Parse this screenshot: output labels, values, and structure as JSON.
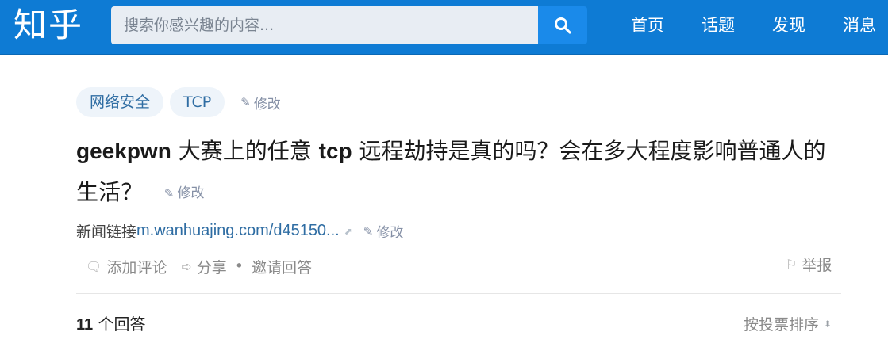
{
  "header": {
    "logo": "知乎",
    "search": {
      "placeholder": "搜索你感兴趣的内容...",
      "value": ""
    },
    "nav": [
      {
        "label": "首页"
      },
      {
        "label": "话题"
      },
      {
        "label": "发现"
      },
      {
        "label": "消息"
      }
    ],
    "brand_color": "#0e7bd4"
  },
  "question": {
    "tags": [
      {
        "label": "网络安全"
      },
      {
        "label": "TCP"
      }
    ],
    "tags_edit": "修改",
    "title_parts": {
      "p1": "geekpwn",
      "p2": " 大赛上的任意 ",
      "p3": "tcp",
      "p4": " 远程劫持是真的吗？会在多大程度影响普通人的生活？"
    },
    "title_edit": "修改",
    "news": {
      "label": "新闻链接",
      "link": "m.wanhuajing.com/d45150...",
      "edit": "修改"
    },
    "actions": {
      "comment": "添加评论",
      "share": "分享",
      "invite": "邀请回答",
      "report": "举报"
    }
  },
  "answers": {
    "count": "11",
    "label": " 个回答",
    "sort": "按投票排序"
  }
}
